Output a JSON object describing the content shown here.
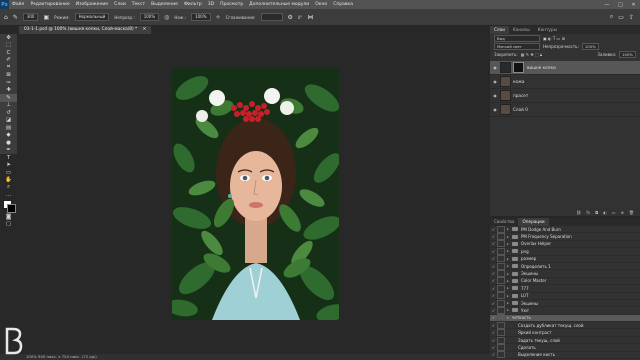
{
  "menu": {
    "logo": "Ps",
    "items": [
      "Файл",
      "Редактирование",
      "Изображение",
      "Слои",
      "Текст",
      "Выделение",
      "Фильтр",
      "3D",
      "Просмотр",
      "Дополнительные модули",
      "Окно",
      "Справка"
    ],
    "window_controls": [
      "—",
      "□",
      "✕"
    ]
  },
  "options": {
    "size": "300",
    "mode_label": "Режим:",
    "mode_value": "Нормальный",
    "opacity_label": "Непрозр.:",
    "opacity_value": "100%",
    "flow_label": "Наж.:",
    "flow_value": "100%",
    "smoothing_label": "Сглаживание:",
    "angle_value": "0°"
  },
  "document": {
    "tab": "03-1-1.psd @ 100% (вишня кепки, Слой-маска/8) *",
    "status": "100%   900 пикс. x 754 пикс. (72 ppi)"
  },
  "layers_panel": {
    "tabs": [
      "Слои",
      "Каналы",
      "Контуры"
    ],
    "filter_label": "Вид",
    "blend_mode": "Мягкий свет",
    "opacity_label": "Непрозрачность:",
    "opacity_value": "100%",
    "lock_label": "Закрепить:",
    "fill_label": "Заливка:",
    "fill_value": "100%",
    "layers": [
      {
        "name": "вишня кепки",
        "selected": true,
        "has_mask": true
      },
      {
        "name": "кожа",
        "selected": false,
        "has_mask": false
      },
      {
        "name": "прасет",
        "selected": false,
        "has_mask": false
      },
      {
        "name": "Слой 0",
        "selected": false,
        "has_mask": false
      }
    ]
  },
  "actions_panel": {
    "tabs": [
      "Свойства",
      "Операции"
    ],
    "items": [
      {
        "name": "PM Dodge And Burn",
        "type": "set",
        "selected": false
      },
      {
        "name": "PM Frequency Separation",
        "type": "set",
        "selected": false
      },
      {
        "name": "Overlax Helper",
        "type": "set",
        "selected": false
      },
      {
        "name": "png",
        "type": "set",
        "selected": false
      },
      {
        "name": "размер",
        "type": "set",
        "selected": false
      },
      {
        "name": "Определить 1",
        "type": "set",
        "selected": false
      },
      {
        "name": "Экшены",
        "type": "set",
        "selected": false
      },
      {
        "name": "Color Master",
        "type": "set",
        "selected": false
      },
      {
        "name": "777",
        "type": "set",
        "selected": false
      },
      {
        "name": "LUT",
        "type": "set",
        "selected": false
      },
      {
        "name": "Экшены",
        "type": "set",
        "selected": false
      },
      {
        "name": "Уют",
        "type": "set",
        "selected": false
      },
      {
        "name": "четкость",
        "type": "action",
        "selected": true
      },
      {
        "name": "Создать дубликат текущ. слой",
        "type": "step",
        "selected": false
      },
      {
        "name": "Яркий контраст",
        "type": "step",
        "selected": false
      },
      {
        "name": "Задать текущ. слой",
        "type": "step",
        "selected": false
      },
      {
        "name": "Сделать",
        "type": "step",
        "selected": false
      },
      {
        "name": "Выделение кисть",
        "type": "step",
        "selected": false
      }
    ]
  },
  "colors": {
    "ui_dark": "#282828",
    "panel": "#323232",
    "selected_row": "#575757",
    "accent_blue": "#31a8ff"
  }
}
